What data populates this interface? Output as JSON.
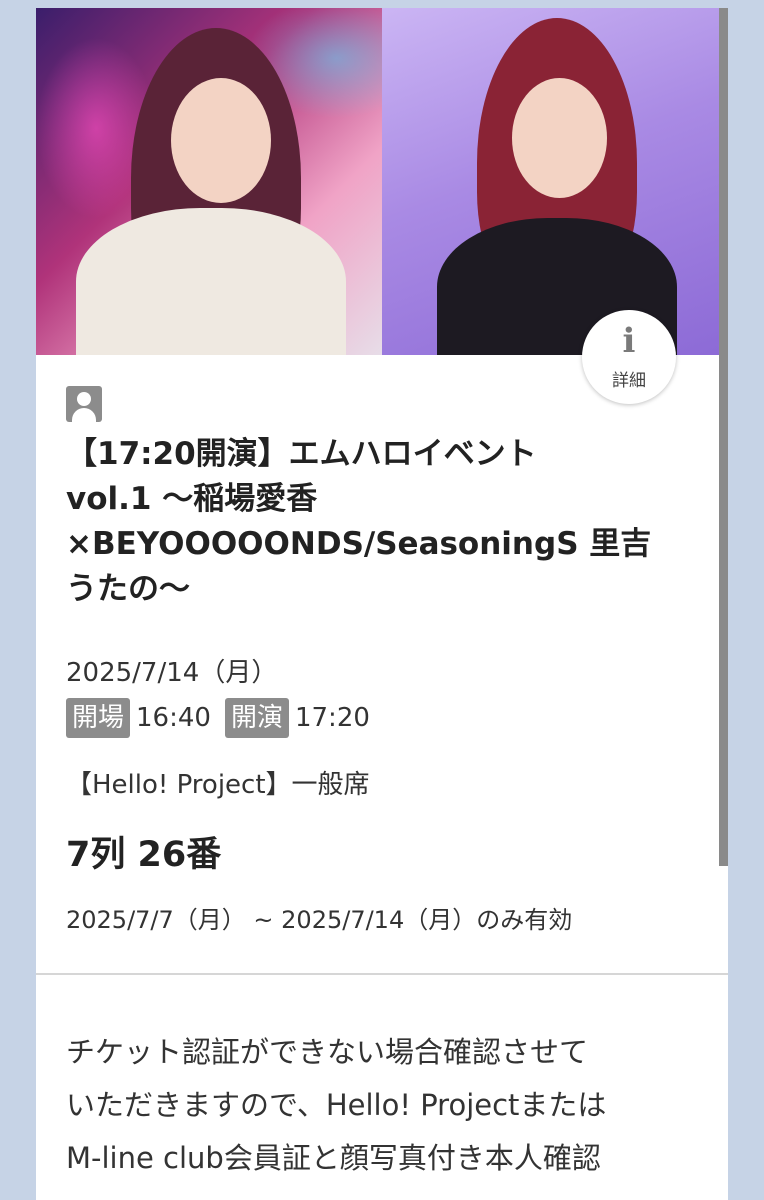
{
  "ticket": {
    "info_button": {
      "icon": "info-icon",
      "glyph": "i",
      "label": "詳細"
    },
    "title_line1": "【17:20開演】エムハロイベント",
    "title_line2": "vol.1 〜稲場愛香",
    "title_line3": "×BEYOOOOONDS/SeasoningS 里吉",
    "title_line4": "うたの〜",
    "date": "2025/7/14（月）",
    "open_label": "開場",
    "open_time": "16:40",
    "start_label": "開演",
    "start_time": "17:20",
    "seat_type": "【Hello! Project】一般席",
    "seat": "7列 26番",
    "validity": "2025/7/7（月） ~ 2025/7/14（月）のみ有効",
    "notice_line1": "チケット認証ができない場合確認させて",
    "notice_line2": "いただきますので、Hello! Projectまたは",
    "notice_line3": "M-line club会員証と顔写真付き本人確認"
  },
  "colors": {
    "background": "#c6d3e6",
    "card": "#ffffff",
    "badge": "#8c8c8c"
  }
}
